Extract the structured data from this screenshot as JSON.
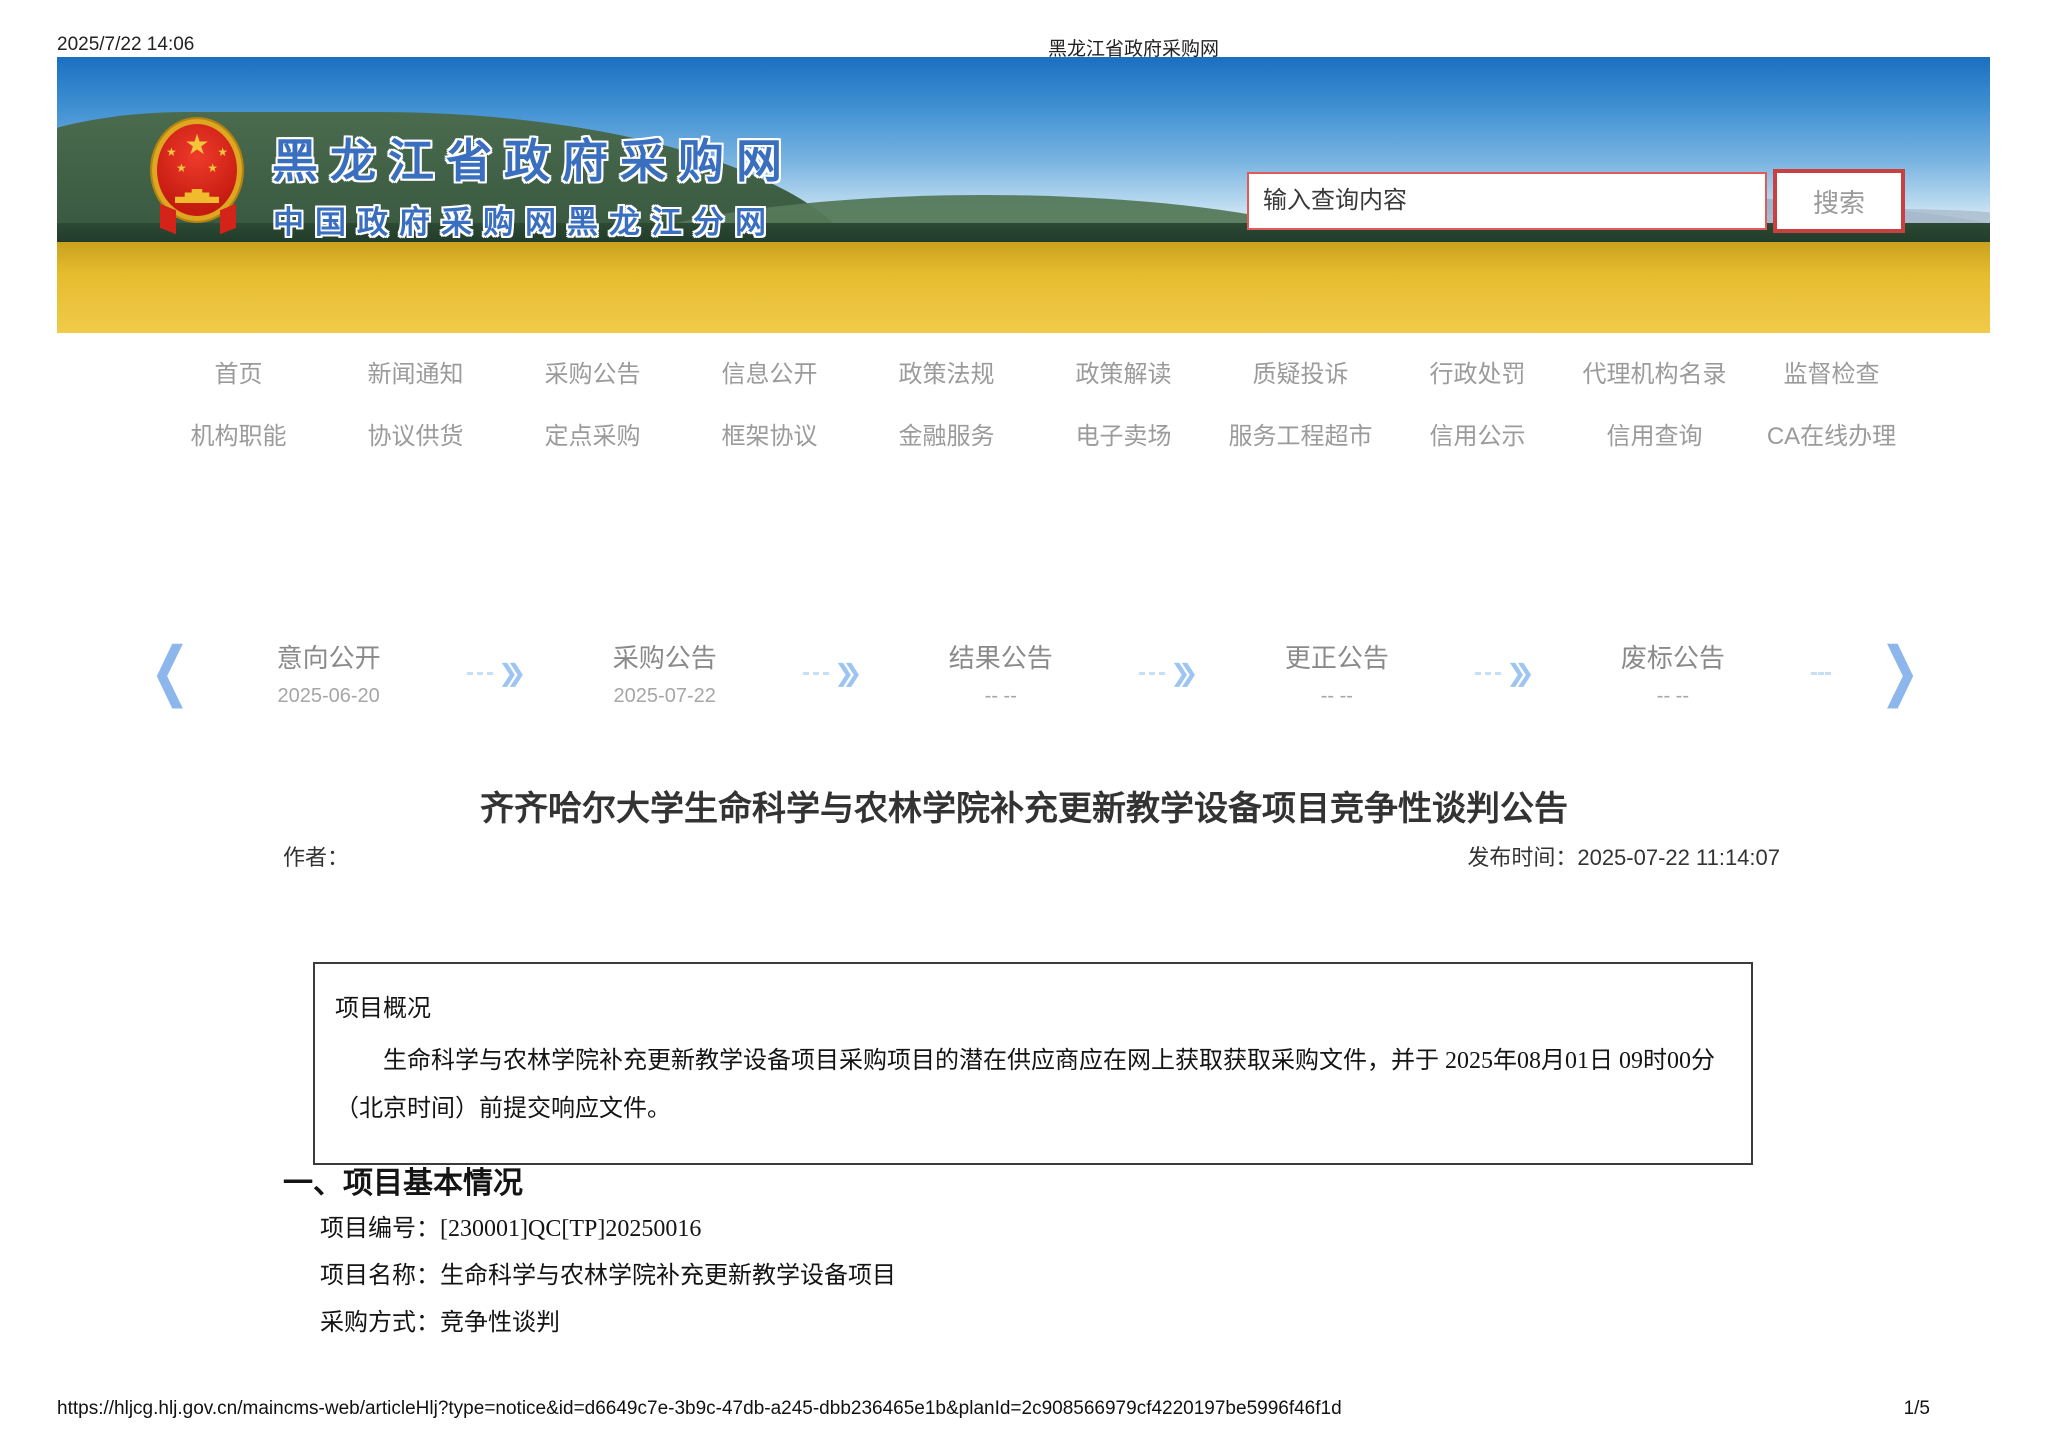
{
  "print_header": {
    "timestamp": "2025/7/22 14:06",
    "title": "黑龙江省政府采购网"
  },
  "banner": {
    "site_name": "黑龙江省政府采购网",
    "site_subtitle": "中国政府采购网黑龙江分网",
    "search": {
      "placeholder": "输入查询内容",
      "button_label": "搜索"
    }
  },
  "nav": {
    "row1": [
      "首页",
      "新闻通知",
      "采购公告",
      "信息公开",
      "政策法规",
      "政策解读",
      "质疑投诉",
      "行政处罚",
      "代理机构名录",
      "监督检查"
    ],
    "row2": [
      "机构职能",
      "协议供货",
      "定点采购",
      "框架协议",
      "金融服务",
      "电子卖场",
      "服务工程超市",
      "信用公示",
      "信用查询",
      "CA在线办理"
    ]
  },
  "timeline": {
    "stages": [
      {
        "label": "意向公开",
        "date": "2025-06-20"
      },
      {
        "label": "采购公告",
        "date": "2025-07-22"
      },
      {
        "label": "结果公告",
        "date": "-- --"
      },
      {
        "label": "更正公告",
        "date": "-- --"
      },
      {
        "label": "废标公告",
        "date": "-- --"
      }
    ]
  },
  "article": {
    "title": "齐齐哈尔大学生命科学与农林学院补充更新教学设备项目竞争性谈判公告",
    "author_label": "作者：",
    "publish_time_label": "发布时间：2025-07-22 11:14:07",
    "overview": {
      "heading": "项目概况",
      "body": "生命科学与农林学院补充更新教学设备项目采购项目的潜在供应商应在网上获取获取采购文件，并于 2025年08月01日 09时00分 （北京时间）前提交响应文件。"
    },
    "section_basic": {
      "heading": "一、项目基本情况",
      "items": [
        "项目编号：[230001]QC[TP]20250016",
        "项目名称：生命科学与农林学院补充更新教学设备项目",
        "采购方式：竞争性谈判"
      ]
    }
  },
  "print_footer": {
    "url": "https://hljcg.hlj.gov.cn/maincms-web/articleHlj?type=notice&id=d6649c7e-3b9c-47db-a245-dbb236465e1b&planId=2c908566979cf4220197be5996f46f1d",
    "page": "1/5"
  },
  "icons": {
    "chevron_left": "❮",
    "chevron_right": "❯",
    "double_arrow": "❯❯",
    "star": "★"
  },
  "colors": {
    "accent_red": "#c94040",
    "banner_text_blue": "#3a6fc0",
    "nav_gray": "#9b9b9b",
    "timeline_blue": "#9dc4f1",
    "field_gold": "#e6bc2e"
  }
}
